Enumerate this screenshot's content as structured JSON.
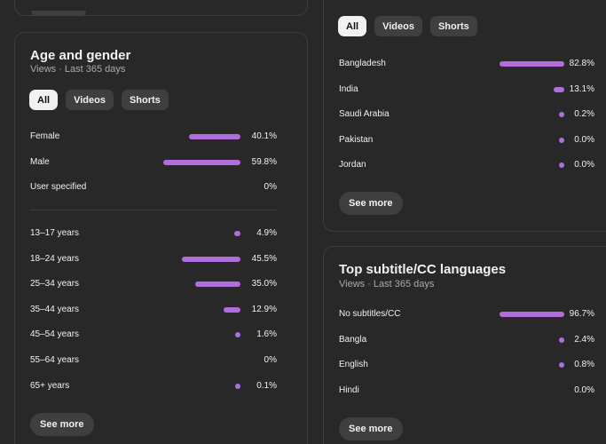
{
  "age_gender": {
    "title": "Age and gender",
    "subtitle": "Views · Last 365 days",
    "chips": [
      "All",
      "Videos",
      "Shorts"
    ],
    "gender": [
      {
        "label": "Female",
        "pct": "40.1%",
        "value": 40.1
      },
      {
        "label": "Male",
        "pct": "59.8%",
        "value": 59.8
      },
      {
        "label": "User specified",
        "pct": "0%",
        "value": 0
      }
    ],
    "age": [
      {
        "label": "13–17 years",
        "pct": "4.9%",
        "value": 4.9
      },
      {
        "label": "18–24 years",
        "pct": "45.5%",
        "value": 45.5
      },
      {
        "label": "25–34 years",
        "pct": "35.0%",
        "value": 35.0
      },
      {
        "label": "35–44 years",
        "pct": "12.9%",
        "value": 12.9
      },
      {
        "label": "45–54 years",
        "pct": "1.6%",
        "value": 1.6
      },
      {
        "label": "55–64 years",
        "pct": "0%",
        "value": 0
      },
      {
        "label": "65+ years",
        "pct": "0.1%",
        "value": 0.1
      }
    ],
    "see_more": "See more"
  },
  "geography": {
    "chips": [
      "All",
      "Videos",
      "Shorts"
    ],
    "rows": [
      {
        "label": "Bangladesh",
        "pct": "82.8%",
        "value": 82.8
      },
      {
        "label": "India",
        "pct": "13.1%",
        "value": 13.1
      },
      {
        "label": "Saudi Arabia",
        "pct": "0.2%",
        "value": 0.2
      },
      {
        "label": "Pakistan",
        "pct": "0.0%",
        "value": 0.0
      },
      {
        "label": "Jordan",
        "pct": "0.0%",
        "value": 0.0
      }
    ],
    "see_more": "See more"
  },
  "subtitles": {
    "title": "Top subtitle/CC languages",
    "subtitle": "Views · Last 365 days",
    "rows": [
      {
        "label": "No subtitles/CC",
        "pct": "96.7%",
        "value": 96.7
      },
      {
        "label": "Bangla",
        "pct": "2.4%",
        "value": 2.4
      },
      {
        "label": "English",
        "pct": "0.8%",
        "value": 0.8
      },
      {
        "label": "Hindi",
        "pct": "0.0%",
        "value": 0.0,
        "no_dot": true
      }
    ],
    "see_more": "See more"
  },
  "colors": {
    "bar": "#b26ddc",
    "background": "#282828",
    "chip_active": "#f1f1f1"
  }
}
